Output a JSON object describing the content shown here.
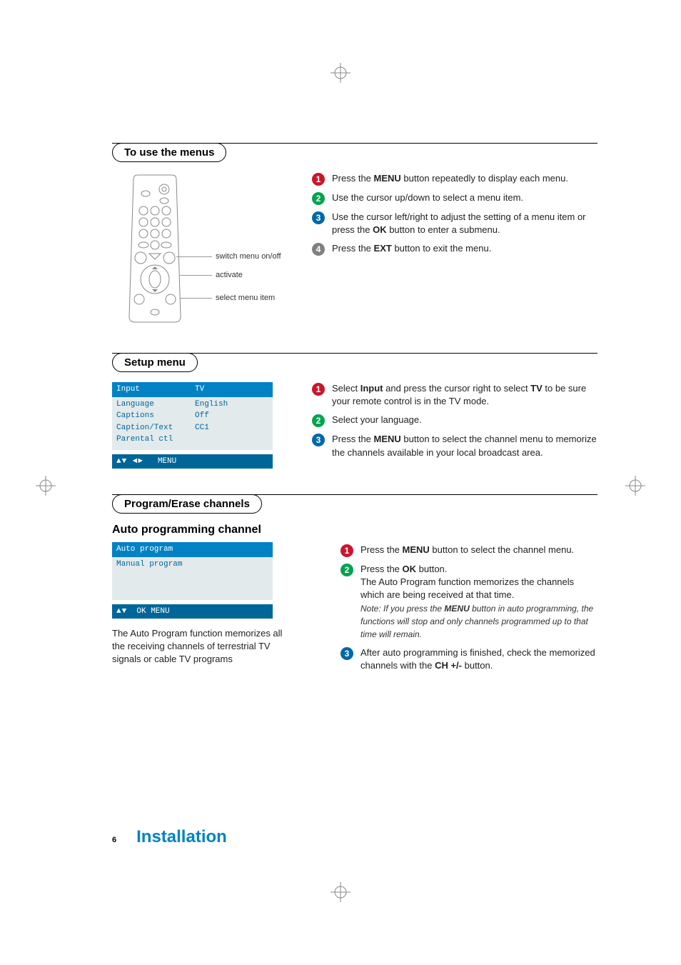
{
  "sections": {
    "to_use_menus": {
      "title": "To use the menus",
      "remote_labels": {
        "switch": "switch menu on/off",
        "activate": "activate",
        "select": "select menu item"
      },
      "steps": [
        {
          "badge": "1",
          "color": "red",
          "text_parts": [
            "Press the ",
            "MENU",
            " button repeatedly to display each menu."
          ]
        },
        {
          "badge": "2",
          "color": "green",
          "text_parts": [
            "Use the cursor up/down to select a menu item."
          ]
        },
        {
          "badge": "3",
          "color": "blue",
          "text_parts": [
            "Use the cursor left/right to adjust the setting of a menu item or press the ",
            "OK",
            " button to enter a submenu."
          ]
        },
        {
          "badge": "4",
          "color": "grey",
          "text_parts": [
            "Press the ",
            "EXT",
            " button to exit the menu."
          ]
        }
      ]
    },
    "setup_menu": {
      "title": "Setup menu",
      "menu": {
        "header_left": "Input",
        "header_right": "TV",
        "rows": [
          {
            "label": "Language",
            "value": "English"
          },
          {
            "label": "Captions",
            "value": "Off"
          },
          {
            "label": "Caption/Text",
            "value": "CC1"
          },
          {
            "label": "Parental ctl",
            "value": ""
          }
        ],
        "footer_arrows": "▲▼ ◄►",
        "footer_text": "MENU"
      },
      "steps": [
        {
          "badge": "1",
          "color": "red",
          "text_parts": [
            "Select ",
            "Input",
            " and press the cursor right to select ",
            "TV",
            " to be sure your remote control is in the TV mode."
          ]
        },
        {
          "badge": "2",
          "color": "green",
          "text_parts": [
            "Select your language."
          ]
        },
        {
          "badge": "3",
          "color": "blue",
          "text_parts": [
            "Press the ",
            "MENU",
            " button to select the channel menu to memorize the channels available in your local broadcast area."
          ]
        }
      ]
    },
    "program_erase": {
      "title": "Program/Erase channels",
      "subsection_title": "Auto programming channel",
      "menu": {
        "header_left": "Auto program",
        "header_right": "",
        "rows": [
          {
            "label": "Manual program",
            "value": ""
          }
        ],
        "footer_arrows": "▲▼",
        "footer_text": "OK MENU"
      },
      "body_para": "The Auto Program function memorizes all the receiving channels of terrestrial TV signals or cable TV programs",
      "steps": [
        {
          "badge": "1",
          "color": "red",
          "text_parts": [
            "Press the ",
            "MENU",
            " button to select the channel menu."
          ]
        },
        {
          "badge": "2",
          "color": "green",
          "text_parts": [
            "Press the ",
            "OK",
            " button."
          ],
          "followup": "The Auto Program function memorizes the channels which are being received at that time.",
          "note_parts": [
            "Note: If you press the ",
            "MENU",
            " button in auto programming, the functions will stop and only channels programmed up to that time will remain."
          ]
        },
        {
          "badge": "3",
          "color": "blue",
          "text_parts": [
            "After auto programming is finished, check the memorized channels with the ",
            "CH +/-",
            " button."
          ]
        }
      ]
    }
  },
  "footer": {
    "page_num": "6",
    "title": "Installation"
  }
}
